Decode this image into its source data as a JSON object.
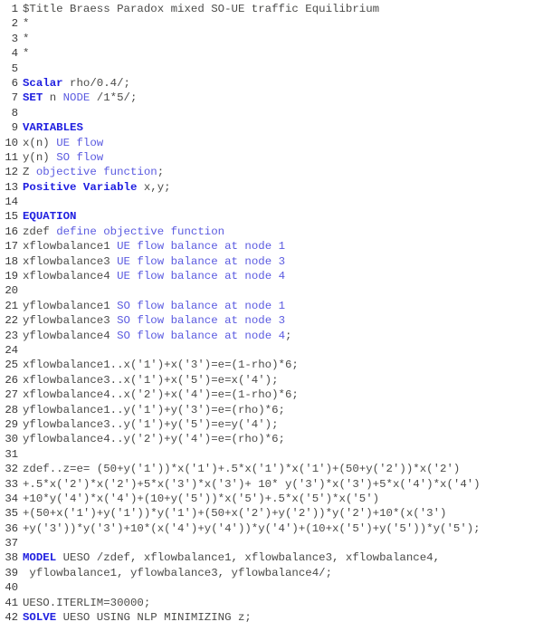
{
  "editor": {
    "kind": "gams-source-listing",
    "colors": {
      "background": "#ffffff",
      "line_number": "#3a3a3a",
      "keyword": "#2020e0",
      "identifier": "#5a5ae0",
      "comment": "#4a4a48",
      "plain": "#4a4a48"
    },
    "first_line_number": 1,
    "last_line_number": 42
  },
  "lines": [
    {
      "n": "1",
      "tokens": [
        {
          "t": "$Title Braess Paradox mixed SO-UE traffic Equilibrium",
          "c": "cmt"
        }
      ]
    },
    {
      "n": "2",
      "tokens": [
        {
          "t": "*",
          "c": "cmt"
        }
      ]
    },
    {
      "n": "3",
      "tokens": [
        {
          "t": "*",
          "c": "cmt"
        }
      ]
    },
    {
      "n": "4",
      "tokens": [
        {
          "t": "*",
          "c": "cmt"
        }
      ]
    },
    {
      "n": "5",
      "tokens": [
        {
          "t": "",
          "c": "plain"
        }
      ]
    },
    {
      "n": "6",
      "tokens": [
        {
          "t": "Scalar",
          "c": "kw"
        },
        {
          "t": " rho/0.4/;",
          "c": "plain"
        }
      ]
    },
    {
      "n": "7",
      "tokens": [
        {
          "t": "SET",
          "c": "kw"
        },
        {
          "t": " n ",
          "c": "plain"
        },
        {
          "t": "NODE",
          "c": "id"
        },
        {
          "t": " /1*5/;",
          "c": "plain"
        }
      ]
    },
    {
      "n": "8",
      "tokens": [
        {
          "t": "",
          "c": "plain"
        }
      ]
    },
    {
      "n": "9",
      "tokens": [
        {
          "t": "VARIABLES",
          "c": "kw"
        }
      ]
    },
    {
      "n": "10",
      "tokens": [
        {
          "t": "x(n) ",
          "c": "plain"
        },
        {
          "t": "UE flow",
          "c": "id"
        }
      ]
    },
    {
      "n": "11",
      "tokens": [
        {
          "t": "y(n) ",
          "c": "plain"
        },
        {
          "t": "SO flow",
          "c": "id"
        }
      ]
    },
    {
      "n": "12",
      "tokens": [
        {
          "t": "Z ",
          "c": "plain"
        },
        {
          "t": "objective function",
          "c": "id"
        },
        {
          "t": ";",
          "c": "plain"
        }
      ]
    },
    {
      "n": "13",
      "tokens": [
        {
          "t": "Positive Variable",
          "c": "kw"
        },
        {
          "t": " x,y;",
          "c": "plain"
        }
      ]
    },
    {
      "n": "14",
      "tokens": [
        {
          "t": "",
          "c": "plain"
        }
      ]
    },
    {
      "n": "15",
      "tokens": [
        {
          "t": "EQUATION",
          "c": "kw"
        }
      ]
    },
    {
      "n": "16",
      "tokens": [
        {
          "t": "zdef ",
          "c": "plain"
        },
        {
          "t": "define objective function",
          "c": "id"
        }
      ]
    },
    {
      "n": "17",
      "tokens": [
        {
          "t": "xflowbalance1 ",
          "c": "plain"
        },
        {
          "t": "UE flow balance at node 1",
          "c": "id"
        }
      ]
    },
    {
      "n": "18",
      "tokens": [
        {
          "t": "xflowbalance3 ",
          "c": "plain"
        },
        {
          "t": "UE flow balance at node 3",
          "c": "id"
        }
      ]
    },
    {
      "n": "19",
      "tokens": [
        {
          "t": "xflowbalance4 ",
          "c": "plain"
        },
        {
          "t": "UE flow balance at node 4",
          "c": "id"
        }
      ]
    },
    {
      "n": "20",
      "tokens": [
        {
          "t": "",
          "c": "plain"
        }
      ]
    },
    {
      "n": "21",
      "tokens": [
        {
          "t": "yflowbalance1 ",
          "c": "plain"
        },
        {
          "t": "SO flow balance at node 1",
          "c": "id"
        }
      ]
    },
    {
      "n": "22",
      "tokens": [
        {
          "t": "yflowbalance3 ",
          "c": "plain"
        },
        {
          "t": "SO flow balance at node 3",
          "c": "id"
        }
      ]
    },
    {
      "n": "23",
      "tokens": [
        {
          "t": "yflowbalance4 ",
          "c": "plain"
        },
        {
          "t": "SO flow balance at node 4",
          "c": "id"
        },
        {
          "t": ";",
          "c": "plain"
        }
      ]
    },
    {
      "n": "24",
      "tokens": [
        {
          "t": "",
          "c": "plain"
        }
      ]
    },
    {
      "n": "25",
      "tokens": [
        {
          "t": "xflowbalance1..x('1')+x('3')=e=(1-rho)*6;",
          "c": "plain"
        }
      ]
    },
    {
      "n": "26",
      "tokens": [
        {
          "t": "xflowbalance3..x('1')+x('5')=e=x('4');",
          "c": "plain"
        }
      ]
    },
    {
      "n": "27",
      "tokens": [
        {
          "t": "xflowbalance4..x('2')+x('4')=e=(1-rho)*6;",
          "c": "plain"
        }
      ]
    },
    {
      "n": "28",
      "tokens": [
        {
          "t": "yflowbalance1..y('1')+y('3')=e=(rho)*6;",
          "c": "plain"
        }
      ]
    },
    {
      "n": "29",
      "tokens": [
        {
          "t": "yflowbalance3..y('1')+y('5')=e=y('4');",
          "c": "plain"
        }
      ]
    },
    {
      "n": "30",
      "tokens": [
        {
          "t": "yflowbalance4..y('2')+y('4')=e=(rho)*6;",
          "c": "plain"
        }
      ]
    },
    {
      "n": "31",
      "tokens": [
        {
          "t": "",
          "c": "plain"
        }
      ]
    },
    {
      "n": "32",
      "tokens": [
        {
          "t": "zdef..z=e= (50+y('1'))*x('1')+.5*x('1')*x('1')+(50+y('2'))*x('2')",
          "c": "plain"
        }
      ]
    },
    {
      "n": "33",
      "tokens": [
        {
          "t": "+.5*x('2')*x('2')+5*x('3')*x('3')+ 10* y('3')*x('3')+5*x('4')*x('4')",
          "c": "plain"
        }
      ]
    },
    {
      "n": "34",
      "tokens": [
        {
          "t": "+10*y('4')*x('4')+(10+y('5'))*x('5')+.5*x('5')*x('5')",
          "c": "plain"
        }
      ]
    },
    {
      "n": "35",
      "tokens": [
        {
          "t": "+(50+x('1')+y('1'))*y('1')+(50+x('2')+y('2'))*y('2')+10*(x('3')",
          "c": "plain"
        }
      ]
    },
    {
      "n": "36",
      "tokens": [
        {
          "t": "+y('3'))*y('3')+10*(x('4')+y('4'))*y('4')+(10+x('5')+y('5'))*y('5');",
          "c": "plain"
        }
      ]
    },
    {
      "n": "37",
      "tokens": [
        {
          "t": "",
          "c": "plain"
        }
      ]
    },
    {
      "n": "38",
      "tokens": [
        {
          "t": "MODEL",
          "c": "kw"
        },
        {
          "t": " UESO /zdef, xflowbalance1, xflowbalance3, xflowbalance4,",
          "c": "plain"
        }
      ]
    },
    {
      "n": "39",
      "tokens": [
        {
          "t": " yflowbalance1, yflowbalance3, yflowbalance4/;",
          "c": "plain"
        }
      ]
    },
    {
      "n": "40",
      "tokens": [
        {
          "t": "",
          "c": "plain"
        }
      ]
    },
    {
      "n": "41",
      "tokens": [
        {
          "t": "UESO.ITERLIM=30000;",
          "c": "plain"
        }
      ]
    },
    {
      "n": "42",
      "tokens": [
        {
          "t": "SOLVE",
          "c": "kw"
        },
        {
          "t": " UESO USING NLP MINIMIZING z;",
          "c": "plain"
        }
      ]
    }
  ]
}
